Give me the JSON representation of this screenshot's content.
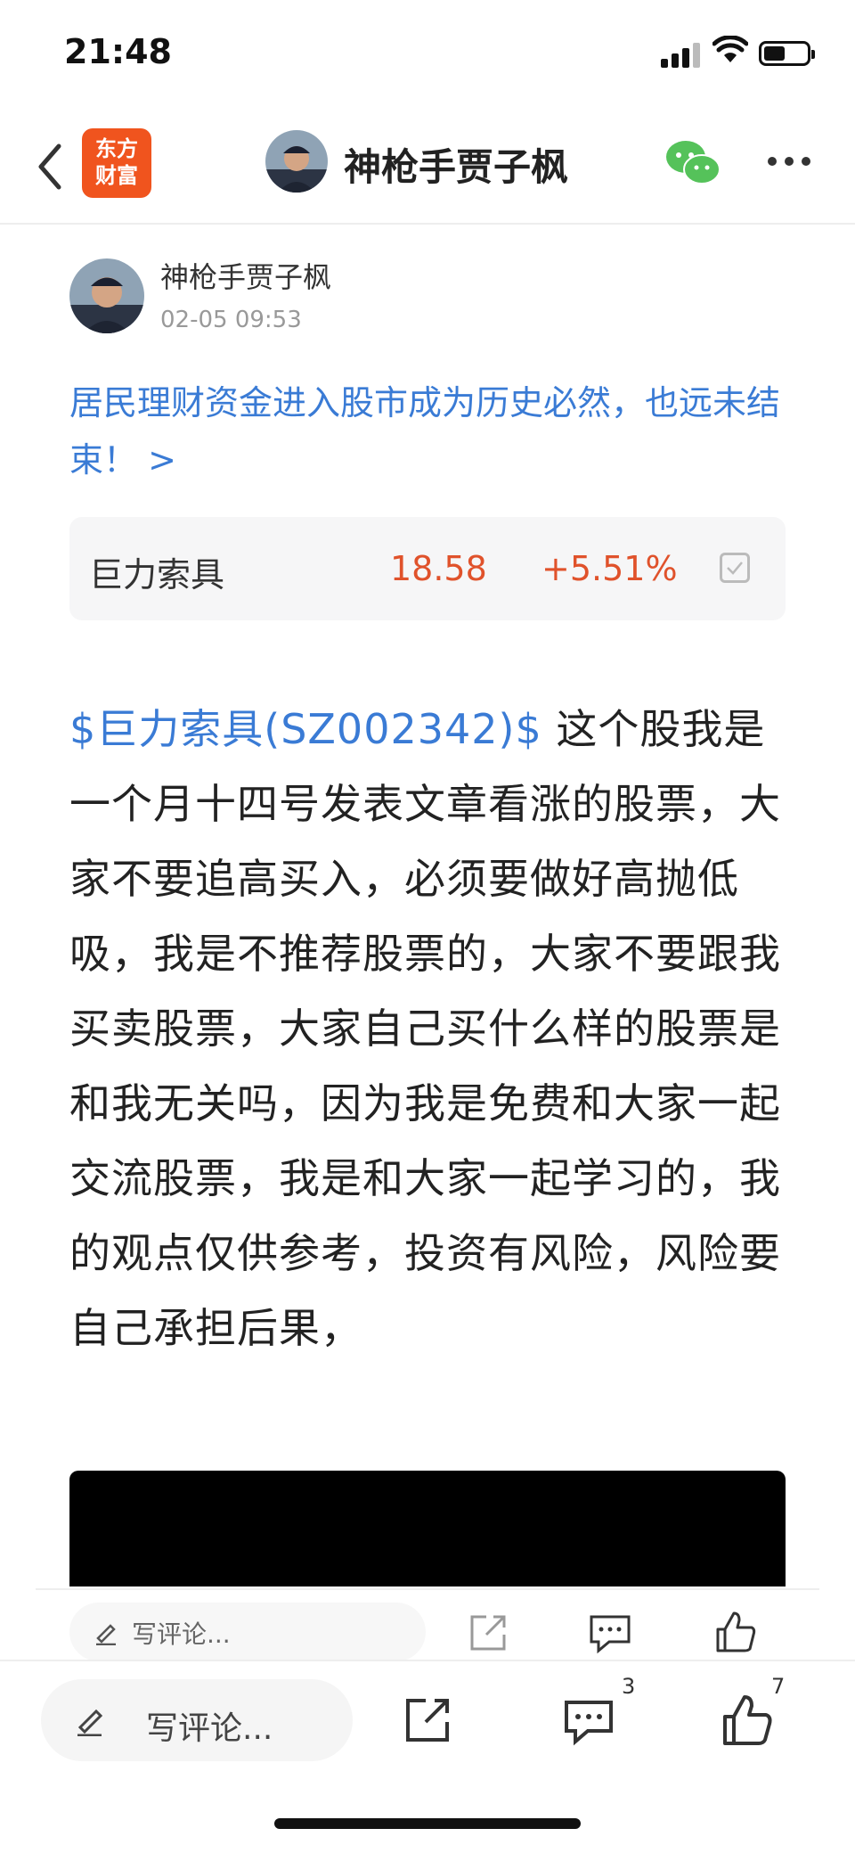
{
  "status_bar": {
    "time": "21:48",
    "battery_level": 0.5
  },
  "nav": {
    "logo_line1": "东方",
    "logo_line2": "财富",
    "title": "神枪手贾子枫",
    "icons": [
      "back-chevron-icon",
      "wechat-icon",
      "more-icon"
    ]
  },
  "post": {
    "author": "神枪手贾子枫",
    "time": "02-05 09:53",
    "article_link": "居民理财资金进入股市成为历史必然，也远未结束！ >",
    "stock_card": {
      "name": "巨力索具",
      "price": "18.58",
      "change": "+5.51%"
    },
    "stock_tag": "$巨力索具(SZ002342)$",
    "body": " 这个股我是一个月十四号发表文章看涨的股票，大家不要追高买入，必须要做好高抛低吸，我是不推荐股票的，大家不要跟我买卖股票，大家自己买什么样的股票是和我无关吗，因为我是免费和大家一起交流股票，我是和大家一起学习的，我的观点仅供参考，投资有风险，风险要自己承担后果，"
  },
  "inner_bar": {
    "placeholder": "写评论..."
  },
  "bottom_bar": {
    "placeholder": "写评论...",
    "comment_count": "3",
    "like_count": "7"
  },
  "colors": {
    "link": "#3a7bd5",
    "up": "#e0522b",
    "brand": "#f0541e"
  }
}
